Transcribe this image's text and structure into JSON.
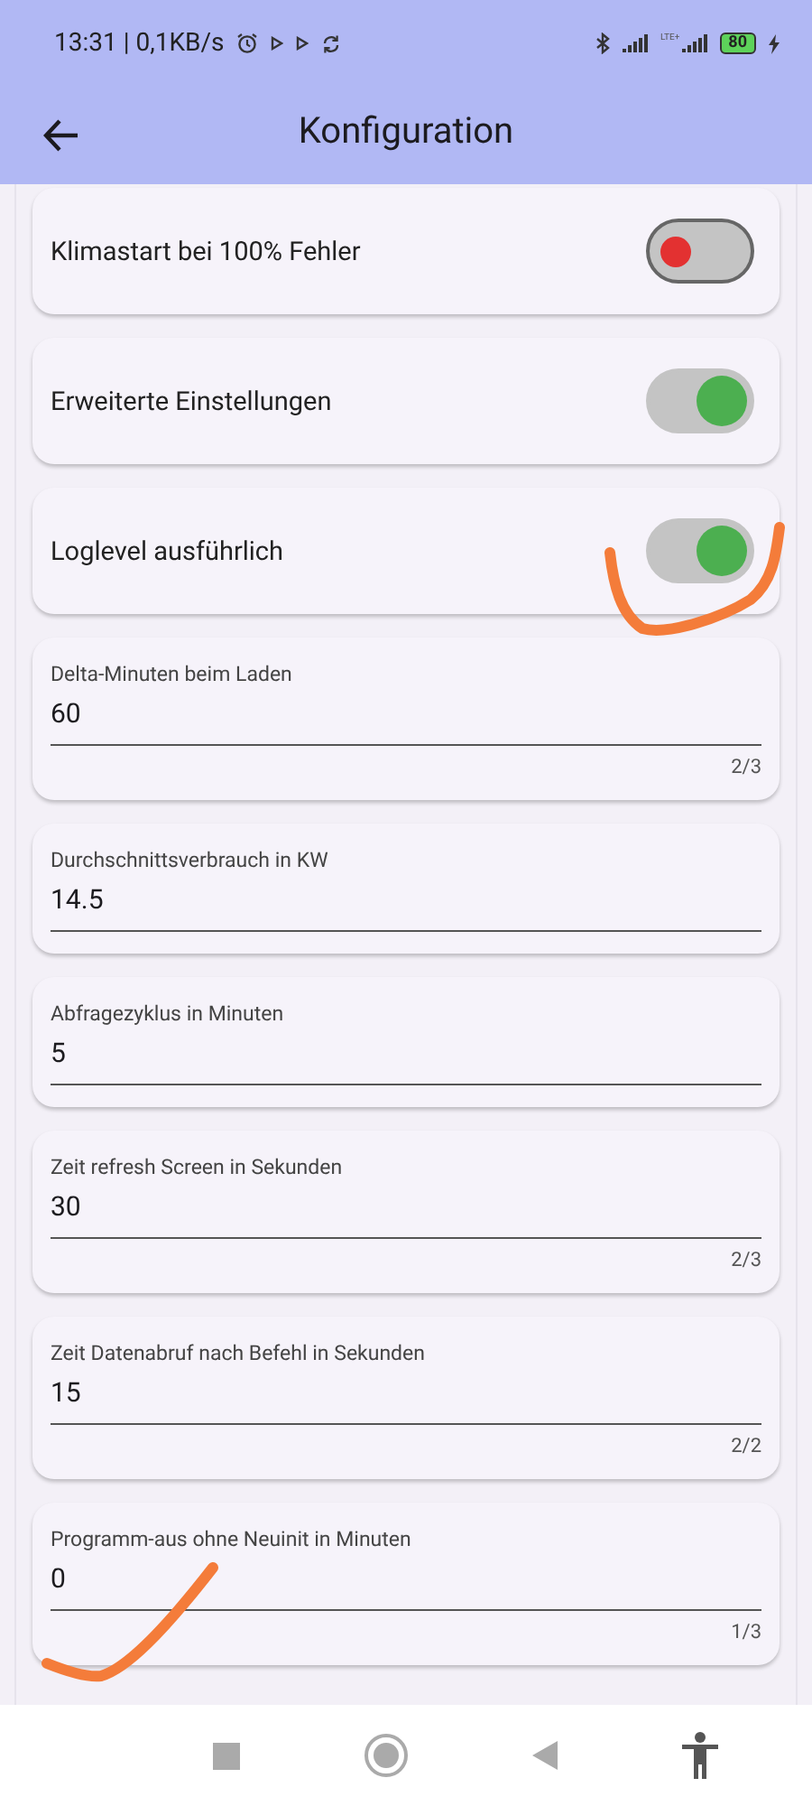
{
  "status_bar": {
    "time": "13:31 | 0,1KB/s",
    "network_label": "LTE+",
    "battery": "80"
  },
  "app_bar": {
    "title": "Konfiguration"
  },
  "settings": [
    {
      "kind": "toggle",
      "label": "Klimastart bei 100% Fehler",
      "on": false
    },
    {
      "kind": "toggle",
      "label": "Erweiterte Einstellungen",
      "on": true
    },
    {
      "kind": "toggle",
      "label": "Loglevel ausführlich",
      "on": true
    },
    {
      "kind": "field",
      "label": "Delta-Minuten beim Laden",
      "value": "60",
      "counter": "2/3"
    },
    {
      "kind": "field",
      "label": "Durchschnittsverbrauch in KW",
      "value": "14.5"
    },
    {
      "kind": "field",
      "label": "Abfragezyklus in Minuten",
      "value": "5"
    },
    {
      "kind": "field",
      "label": "Zeit refresh Screen in Sekunden",
      "value": "30",
      "counter": "2/3"
    },
    {
      "kind": "field",
      "label": "Zeit Datenabruf nach Befehl in Sekunden",
      "value": "15",
      "counter": "2/2"
    },
    {
      "kind": "field",
      "label": "Programm-aus ohne Neuinit in Minuten",
      "value": "0",
      "counter": "1/3"
    }
  ]
}
